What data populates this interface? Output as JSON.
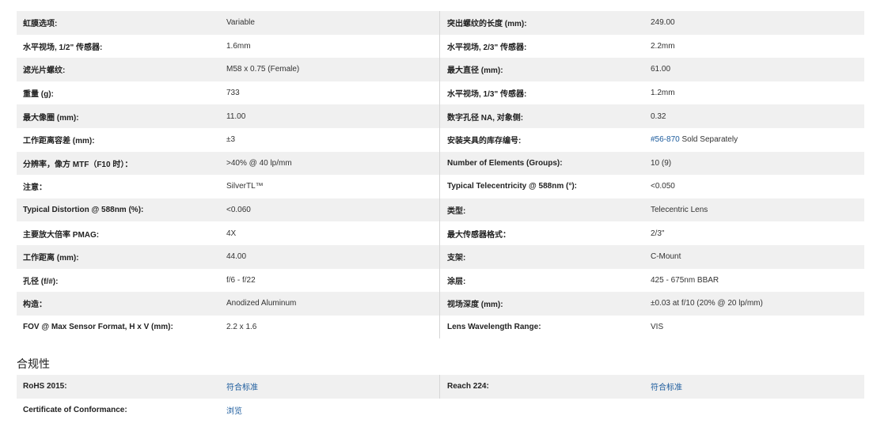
{
  "specs": {
    "rows": [
      {
        "l_label": "虹膜选项:",
        "l_value": "Variable",
        "r_label": "突出螺纹的长度 (mm):",
        "r_value": "249.00"
      },
      {
        "l_label": "水平视场, 1/2\" 传感器:",
        "l_value": "1.6mm",
        "r_label": "水平视场, 2/3\" 传感器:",
        "r_value": "2.2mm"
      },
      {
        "l_label": "滤光片螺纹:",
        "l_value": "M58 x 0.75 (Female)",
        "r_label": "最大直径 (mm):",
        "r_value": "61.00"
      },
      {
        "l_label": "重量 (g):",
        "l_value": "733",
        "r_label": "水平视场, 1/3\" 传感器:",
        "r_value": "1.2mm"
      },
      {
        "l_label": "最大像圈 (mm):",
        "l_value": "11.00",
        "r_label": "数字孔径 NA, 对象侧:",
        "r_value": "0.32"
      },
      {
        "l_label": "工作距离容差 (mm):",
        "l_value": "±3",
        "r_label": "安装夹具的库存编号:",
        "r_value": "",
        "r_link": "#56-870",
        "r_suffix": " Sold Separately"
      },
      {
        "l_label": "分辨率，像方 MTF（F10 时）：",
        "l_value": ">40% @ 40 lp/mm",
        "r_label": "Number of Elements (Groups):",
        "r_value": "10 (9)"
      },
      {
        "l_label": "注意：",
        "l_value": "SilverTL™",
        "r_label": "Typical Telecentricity @ 588nm (°):",
        "r_value": "<0.050"
      },
      {
        "l_label": "Typical Distortion @ 588nm (%):",
        "l_value": "<0.060",
        "r_label": "类型:",
        "r_value": "Telecentric Lens"
      },
      {
        "l_label": "主要放大倍率 PMAG:",
        "l_value": "4X",
        "r_label": "最大传感器格式：",
        "r_value": "2/3\""
      },
      {
        "l_label": "工作距离 (mm):",
        "l_value": "44.00",
        "r_label": "支架:",
        "r_value": "C-Mount"
      },
      {
        "l_label": "孔径 (f/#):",
        "l_value": "f/6 - f/22",
        "r_label": "涂层:",
        "r_value": "425 - 675nm BBAR"
      },
      {
        "l_label": "构造：",
        "l_value": "Anodized Aluminum",
        "r_label": "视场深度 (mm):",
        "r_value": "±0.03 at f/10 (20% @ 20 lp/mm)"
      },
      {
        "l_label": "FOV @ Max Sensor Format, H x V (mm):",
        "l_value": "2.2 x 1.6",
        "r_label": "Lens Wavelength Range:",
        "r_value": "VIS"
      }
    ]
  },
  "compliance": {
    "title": "合规性",
    "rohs_label": "RoHS 2015:",
    "rohs_value": "符合标准",
    "reach_label": "Reach 224:",
    "reach_value": "符合标准",
    "coc_label": "Certificate of Conformance:",
    "coc_value": "浏览"
  },
  "colors": {
    "row_stripe": "#f0f0f0",
    "link": "#1a5a9c"
  }
}
